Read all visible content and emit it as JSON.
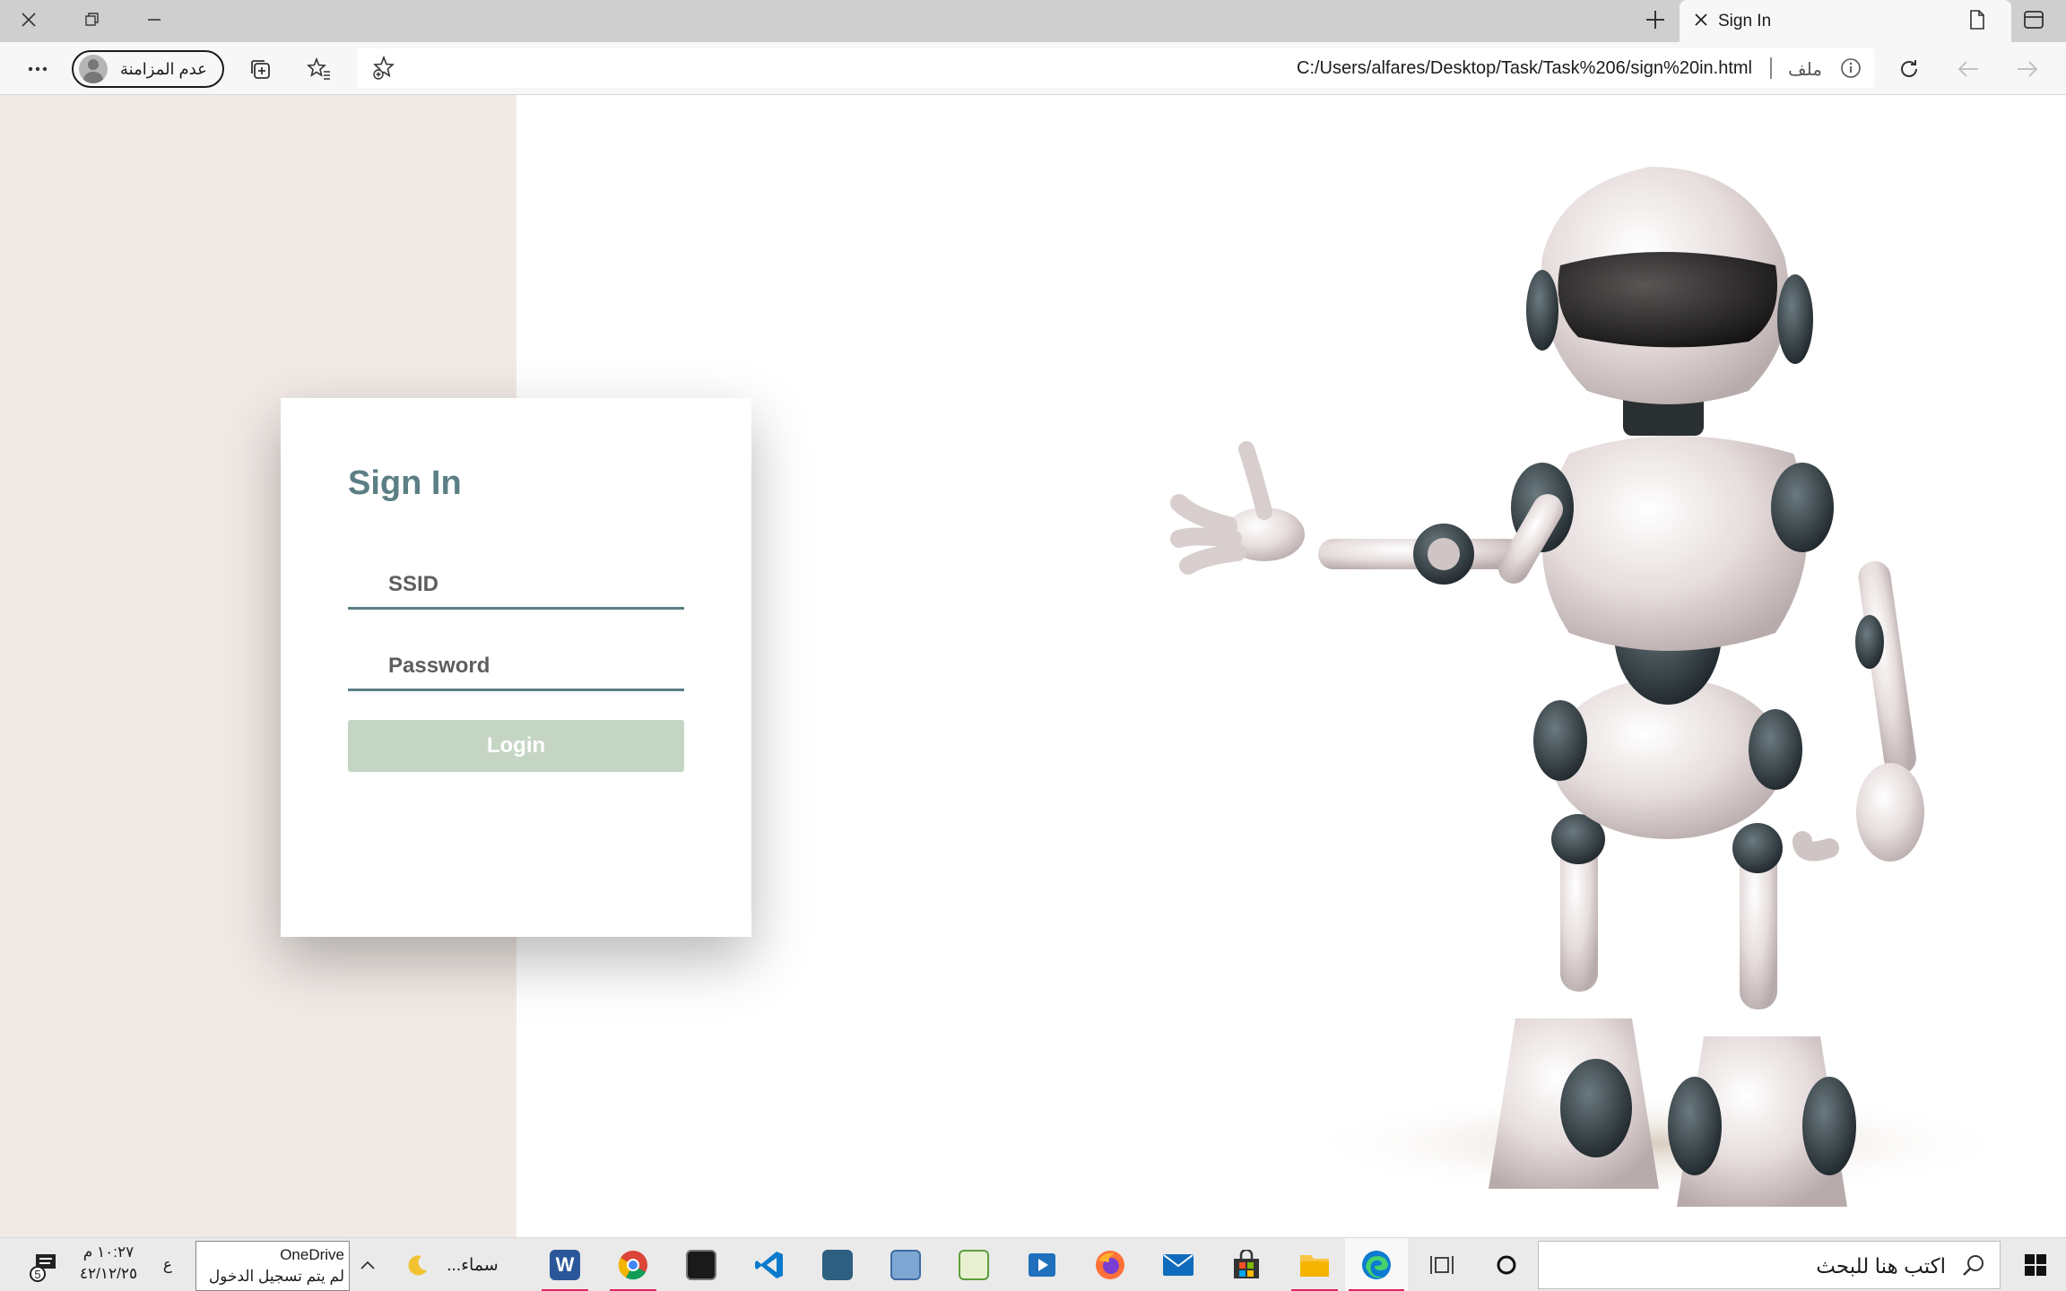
{
  "browser": {
    "tab_title": "Sign In",
    "url": "C:/Users/alfares/Desktop/Task/Task%206/sign%20in.html",
    "url_scheme_label": "ملف",
    "profile_label": "عدم المزامنة"
  },
  "login": {
    "title": "Sign In",
    "ssid_placeholder": "SSID",
    "password_placeholder": "Password",
    "login_label": "Login"
  },
  "colors": {
    "accent": "#5b7f84",
    "left_panel": "#f0e9e5",
    "login_button": "#c5d5c4"
  },
  "taskbar": {
    "search_placeholder": "اكتب هنا للبحث",
    "weather_label": "سماء...",
    "onedrive_title": "OneDrive",
    "onedrive_status": "لم يتم تسجيل الدخول",
    "time": "١٠:٢٧ م",
    "date": "٤٢/١٢/٢٥",
    "language": "ع",
    "notification_count": "5",
    "apps": [
      "word",
      "chrome",
      "terminal",
      "vscode",
      "mysql-workbench",
      "remote-desktop",
      "notepad",
      "media-player",
      "firefox",
      "mail",
      "store",
      "file-explorer",
      "edge"
    ]
  }
}
